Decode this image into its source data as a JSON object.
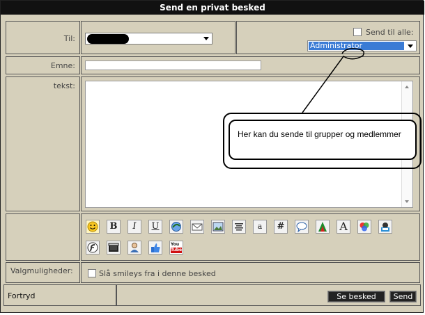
{
  "window": {
    "title": "Send en privat besked"
  },
  "form": {
    "to_label": "Til:",
    "send_all_label": "Send til alle:",
    "group_select_value": "Administrator",
    "subject_label": "Emne:",
    "subject_value": "",
    "text_label": "tekst:",
    "text_value": "",
    "options_label": "Valgmuligheder:",
    "disable_smileys_label": "Slå smileys fra i denne besked"
  },
  "toolbar": {
    "italic": "I",
    "underline": "U",
    "small_a": "a",
    "hash": "#",
    "font_a": "A",
    "youtube_top": "You",
    "youtube_bottom": "Tube"
  },
  "annotation": {
    "text": "Her kan du sende til grupper og medlemmer"
  },
  "footer": {
    "cancel_label": "Fortryd",
    "preview_button": "Se besked",
    "send_button": "Send"
  },
  "colors": {
    "panel_bg": "#d6d0bb",
    "title_bg": "#111111",
    "select_highlight": "#3a7bd5"
  },
  "icons": [
    "smiley-icon",
    "bold-icon",
    "italic-icon",
    "underline-icon",
    "link-icon",
    "email-icon",
    "image-icon",
    "align-icon",
    "font-size-icon",
    "hash-icon",
    "speech-bubble-icon",
    "font-color-icon",
    "font-face-icon",
    "colors-icon",
    "mascot-icon",
    "flash-icon",
    "video-icon",
    "user-icon",
    "thumbs-up-icon",
    "youtube-icon"
  ]
}
